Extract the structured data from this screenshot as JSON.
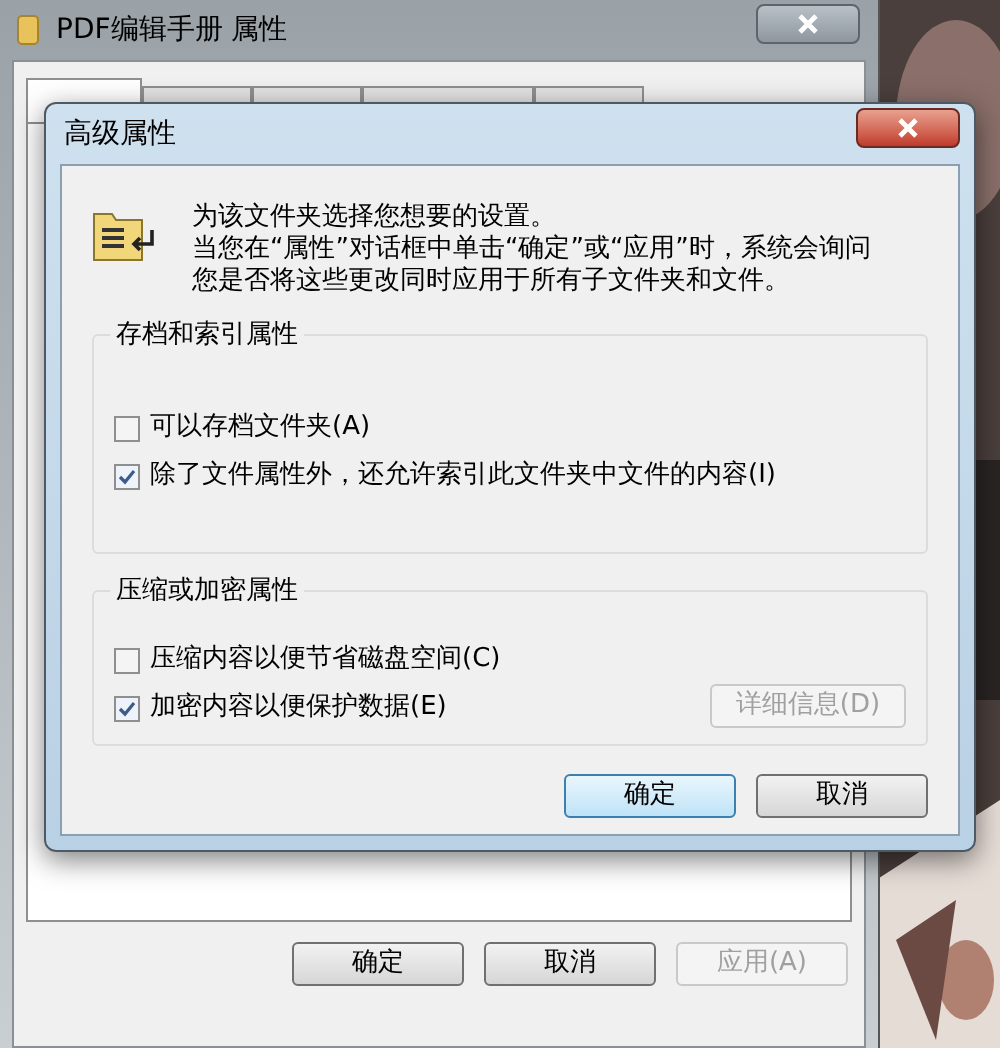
{
  "window": {
    "title": "PDF编辑手册 属性",
    "tabs": [
      {
        "selected": true
      },
      {
        "selected": false
      },
      {
        "selected": false
      },
      {
        "selected": false
      },
      {
        "selected": false
      }
    ],
    "buttons": [
      {
        "label": "确定",
        "disabled": false
      },
      {
        "label": "取消",
        "disabled": false
      },
      {
        "label": "应用(A)",
        "disabled": true
      }
    ]
  },
  "dialog": {
    "title": "高级属性",
    "intro": "为该文件夹选择您想要的设置。",
    "description": "当您在“属性”对话框中单击“确定”或“应用”时，系统会询问您是否将这些更改同时应用于所有子文件夹和文件。",
    "groups": [
      {
        "title": "存档和索引属性",
        "options": [
          {
            "label": "可以存档文件夹(A)",
            "checked": false
          },
          {
            "label": "除了文件属性外，还允许索引此文件夹中文件的内容(I)",
            "checked": true
          }
        ]
      },
      {
        "title": "压缩或加密属性",
        "options": [
          {
            "label": "压缩内容以便节省磁盘空间(C)",
            "checked": false
          },
          {
            "label": "加密内容以便保护数据(E)",
            "checked": true
          }
        ],
        "details_button": {
          "label": "详细信息(D)",
          "disabled": true
        }
      }
    ],
    "buttons": [
      {
        "label": "确定",
        "default": true
      },
      {
        "label": "取消",
        "default": false
      }
    ]
  }
}
